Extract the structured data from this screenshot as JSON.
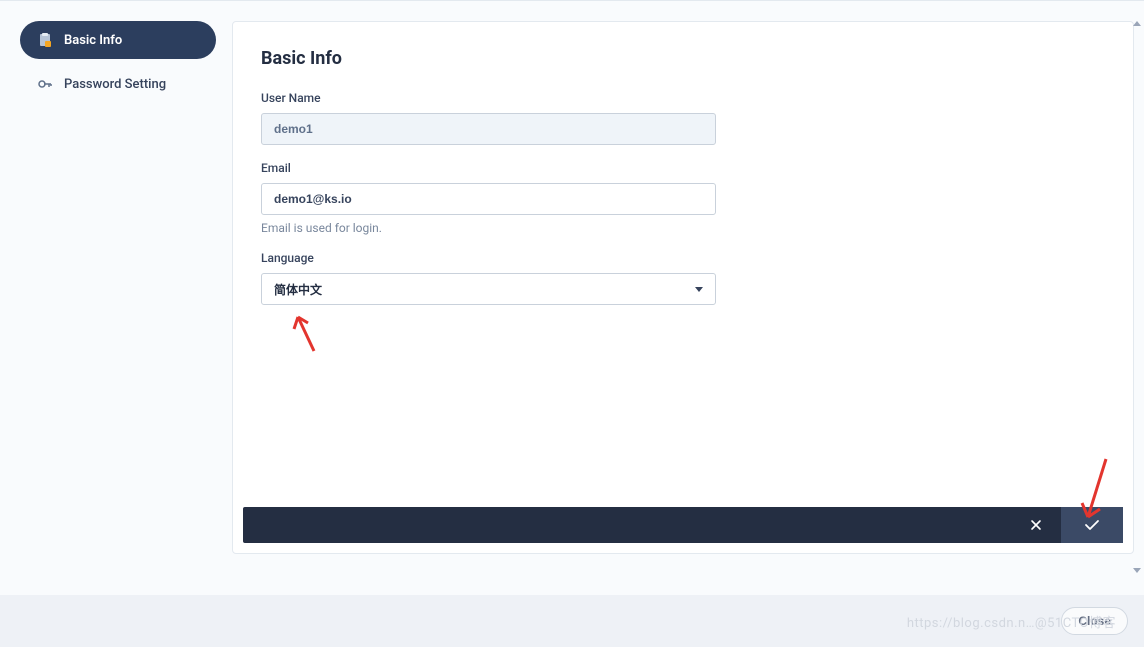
{
  "sidebar": {
    "items": [
      {
        "label": "Basic Info",
        "icon": "clipboard-icon",
        "active": true
      },
      {
        "label": "Password Setting",
        "icon": "key-icon",
        "active": false
      }
    ]
  },
  "page": {
    "title": "Basic Info"
  },
  "form": {
    "username": {
      "label": "User Name",
      "value": "demo1"
    },
    "email": {
      "label": "Email",
      "value": "demo1@ks.io",
      "help": "Email is used for login."
    },
    "language": {
      "label": "Language",
      "selected": "简体中文"
    }
  },
  "footer": {
    "close_label": "Close"
  },
  "watermark": "https://blog.csdn.n…@51CTO博客"
}
